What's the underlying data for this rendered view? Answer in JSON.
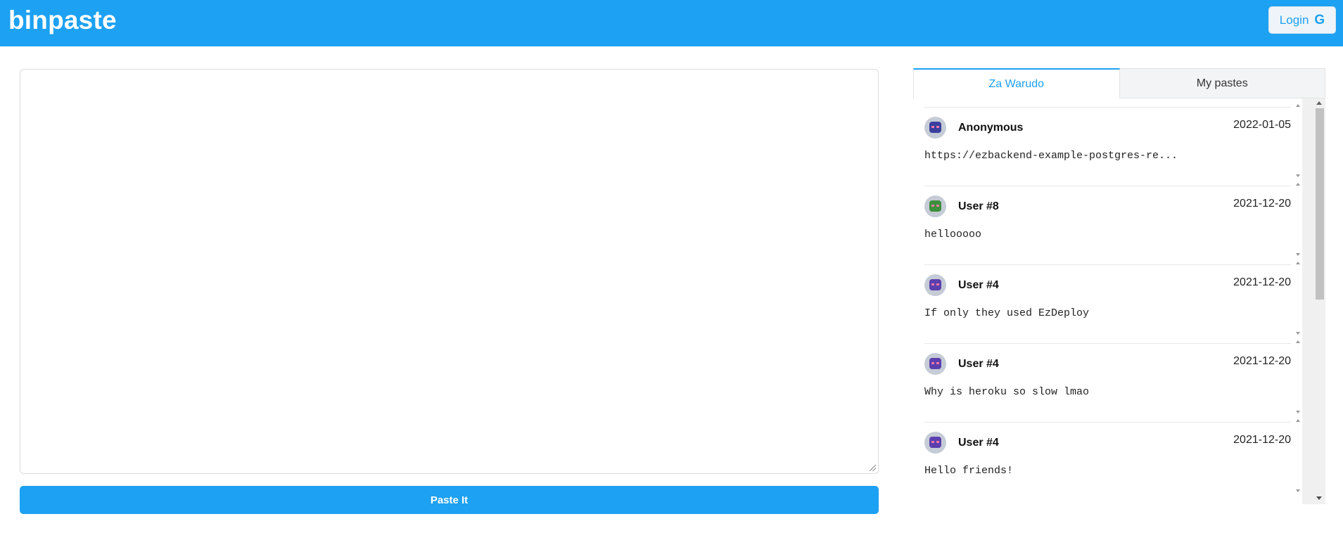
{
  "header": {
    "logo": "binpaste",
    "login_label": "Login",
    "login_icon": "G"
  },
  "editor": {
    "value": "",
    "submit_label": "Paste It"
  },
  "tabs": [
    {
      "label": "Za Warudo",
      "active": true
    },
    {
      "label": "My pastes",
      "active": false
    }
  ],
  "pastes": [
    {
      "user": "Anonymous",
      "date": "2022-01-05",
      "snippet": "https://ezbackend-example-postgres-re...",
      "avatar_color": "#3a3f9e"
    },
    {
      "user": "User #8",
      "date": "2021-12-20",
      "snippet": "hellooooo",
      "avatar_color": "#3c8f3c"
    },
    {
      "user": "User #4",
      "date": "2021-12-20",
      "snippet": "If only they used EzDeploy",
      "avatar_color": "#5b3fae"
    },
    {
      "user": "User #4",
      "date": "2021-12-20",
      "snippet": "Why is heroku so slow lmao",
      "avatar_color": "#5b3fae"
    },
    {
      "user": "User #4",
      "date": "2021-12-20",
      "snippet": "Hello friends!",
      "avatar_color": "#5b3fae"
    }
  ],
  "colors": {
    "brand": "#1da1f2"
  }
}
